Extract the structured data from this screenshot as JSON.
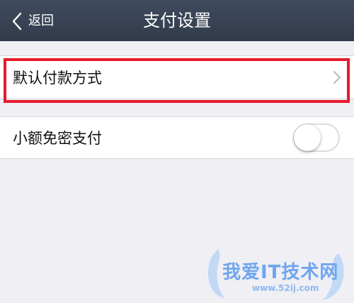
{
  "header": {
    "back_label": "返回",
    "title": "支付设置",
    "background": "#3a4557"
  },
  "settings": {
    "default_payment": {
      "label": "默认付款方式",
      "highlighted": true,
      "highlight_color": "#e8192c",
      "icon": "chevron-right-icon"
    },
    "small_amount_no_password": {
      "label": "小额免密支付",
      "toggle_on": false
    }
  },
  "watermark": {
    "text": "我爱IT技术网",
    "url": "www.52ij.com"
  }
}
